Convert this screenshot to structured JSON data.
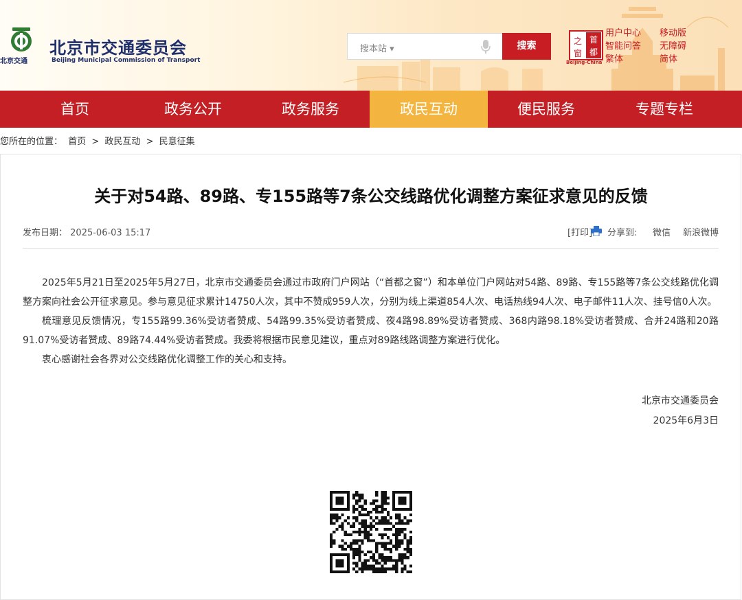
{
  "header": {
    "site_name": "北京市交通委员会",
    "site_name_en": "Beijing Municipal Commission of Transport",
    "logo_mini": "北京交通",
    "search": {
      "scope_label": "搜本站 ▾",
      "button_label": "搜索"
    },
    "gov_portal_logo": {
      "chars": [
        "之",
        "首",
        "窗",
        "都"
      ],
      "caption": "Beijing-China"
    },
    "top_links": [
      "用户中心",
      "移动版",
      "智能问答",
      "无障碍",
      "繁体",
      "简体"
    ]
  },
  "nav": {
    "items": [
      "首页",
      "政务公开",
      "政务服务",
      "政民互动",
      "便民服务",
      "专题专栏"
    ],
    "active_index": 3,
    "colors": {
      "bar": "#c41f25",
      "active": "#f3b53f"
    }
  },
  "breadcrumb": {
    "prefix": "您所在的位置：",
    "items": [
      "首页",
      ">",
      "政民互动",
      ">",
      "民意征集"
    ]
  },
  "article": {
    "title": "关于对54路、89路、专155路等7条公交线路优化调整方案征求意见的反馈",
    "date_label": "发布日期：",
    "date": "2025-06-03 15:17",
    "print_label": "[打印]",
    "share_label": "分享到:",
    "share_wechat": "微信",
    "share_weibo": "新浪微博",
    "paragraphs": [
      "2025年5月21日至2025年5月27日，北京市交通委员会通过市政府门户网站（“首都之窗”）和本单位门户网站对54路、89路、专155路等7条公交线路优化调整方案向社会公开征求意见。参与意见征求累计14750人次，其中不赞成959人次，分别为线上渠道854人次、电话热线94人次、电子邮件11人次、挂号信0人次。",
      "梳理意见反馈情况，专155路99.36%受访者赞成、54路99.35%受访者赞成、夜4路98.89%受访者赞成、368内路98.18%受访者赞成、合并24路和20路91.07%受访者赞成、89路74.44%受访者赞成。我委将根据市民意见建议，重点对89路线路调整方案进行优化。",
      "衷心感谢社会各界对公交线路优化调整工作的关心和支持。"
    ],
    "signature": "北京市交通委员会",
    "sign_date": "2025年6月3日"
  },
  "brand_colors": {
    "red": "#c91d24",
    "navy": "#1f2f6b",
    "gold": "#f3b53f"
  }
}
